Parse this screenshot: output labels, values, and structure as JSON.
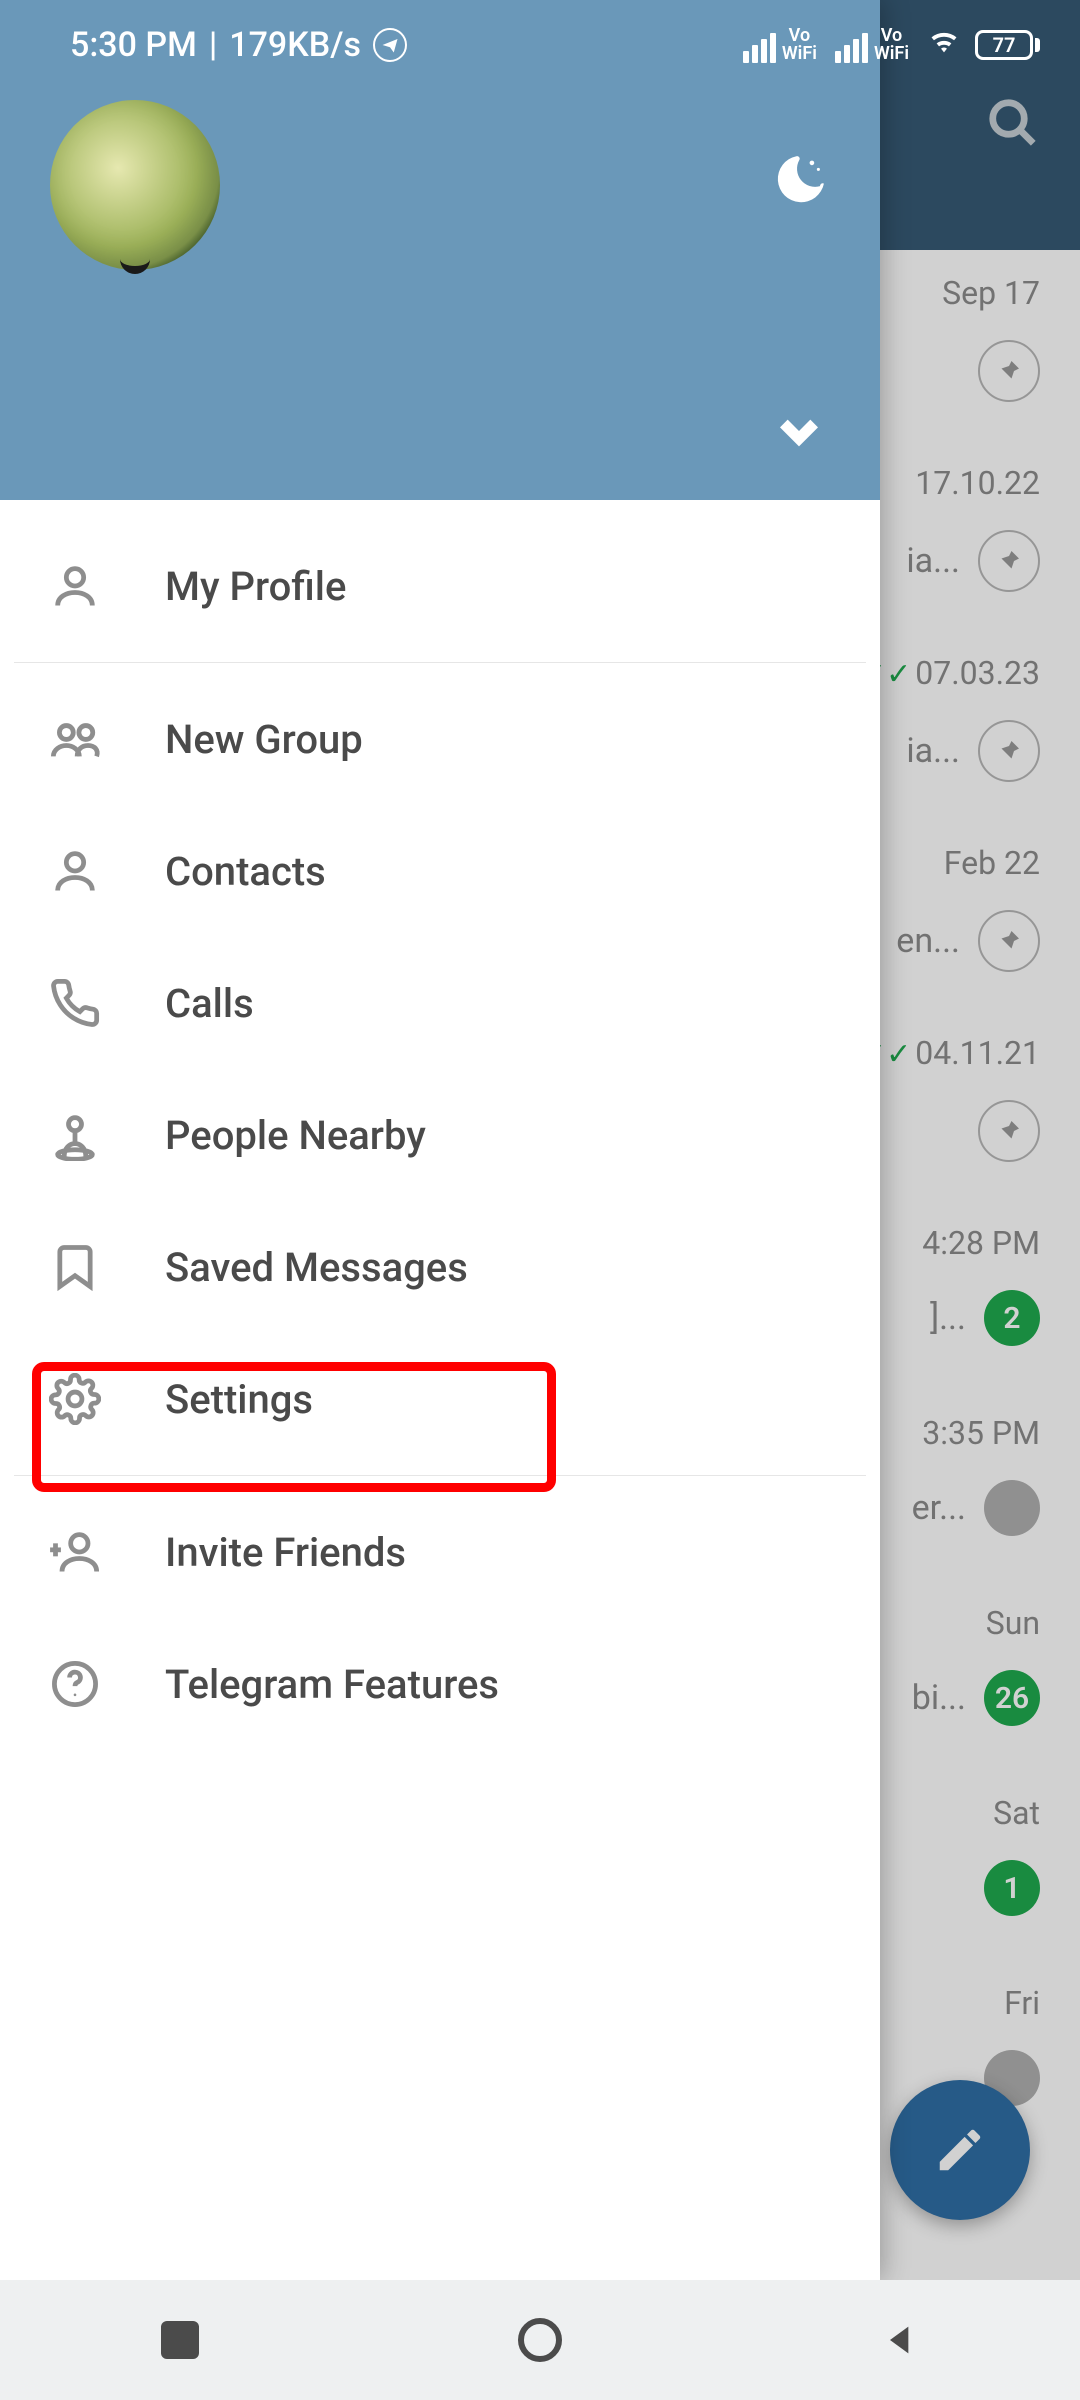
{
  "status": {
    "time": "5:30 PM",
    "net_speed": "179KB/s",
    "vo_wifi_label_top": "Vo",
    "vo_wifi_label_bottom": "WiFi",
    "battery_pct": "77"
  },
  "drawer": {
    "menu": {
      "my_profile": "My Profile",
      "new_group": "New Group",
      "contacts": "Contacts",
      "calls": "Calls",
      "people_nearby": "People Nearby",
      "saved_messages": "Saved Messages",
      "settings": "Settings",
      "invite_friends": "Invite Friends",
      "telegram_features": "Telegram Features"
    }
  },
  "chats": [
    {
      "date": "Sep 17",
      "preview": "",
      "badge_type": "pin"
    },
    {
      "date": "17.10.22",
      "preview": "ia...",
      "badge_type": "pin"
    },
    {
      "date": "07.03.23",
      "preview": "ia...",
      "badge_type": "pin",
      "checks": true
    },
    {
      "date": "Feb 22",
      "preview": "en...",
      "badge_type": "pin"
    },
    {
      "date": "04.11.21",
      "preview": "",
      "badge_type": "pin",
      "checks": true
    },
    {
      "date": "4:28 PM",
      "preview": "]...",
      "badge_type": "unread",
      "badge": "2"
    },
    {
      "date": "3:35 PM",
      "preview": "er...",
      "badge_type": "muted",
      "badge": ""
    },
    {
      "date": "Sun",
      "preview": "bi...",
      "badge_type": "unread",
      "badge": "26"
    },
    {
      "date": "Sat",
      "preview": "",
      "badge_type": "unread",
      "badge": "1"
    },
    {
      "date": "Fri",
      "preview": "",
      "badge_type": "muted",
      "badge": ""
    }
  ]
}
